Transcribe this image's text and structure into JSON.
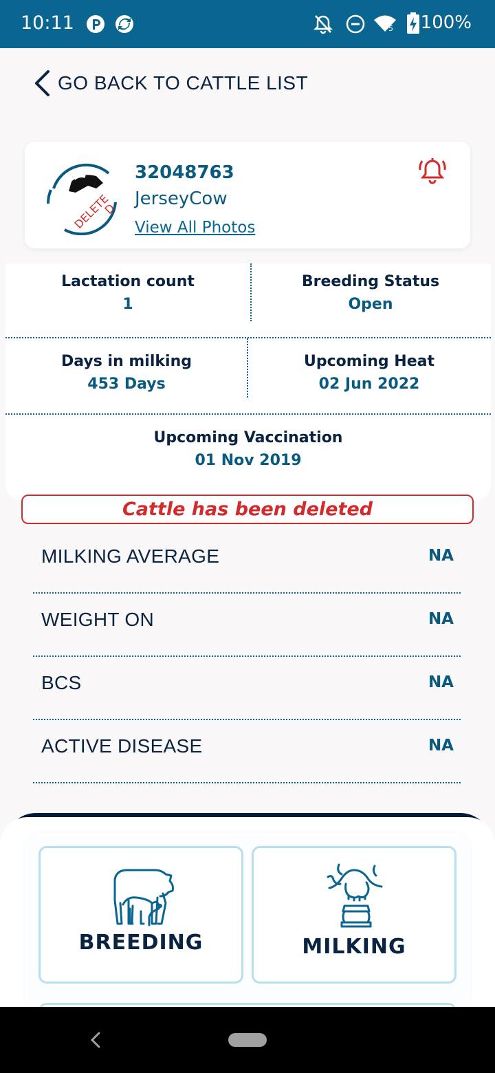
{
  "status_bar": {
    "time": "10:11",
    "battery": "100%",
    "network_badge": "5"
  },
  "back": {
    "label": "GO BACK TO CATTLE LIST"
  },
  "profile": {
    "id": "32048763",
    "breed": "JerseyCow",
    "view_photos": "View All Photos",
    "stamp_line1": "DELETE",
    "stamp_line2": "D"
  },
  "stats": {
    "lactation_label": "Lactation count",
    "lactation_value": "1",
    "breeding_label": "Breeding Status",
    "breeding_value": "Open",
    "milking_days_label": "Days in milking",
    "milking_days_value": "453 Days",
    "heat_label": "Upcoming Heat",
    "heat_value": "02 Jun 2022",
    "vaccination_label": "Upcoming Vaccination",
    "vaccination_value": "01 Nov 2019"
  },
  "banner": {
    "text": "Cattle has been deleted"
  },
  "info": [
    {
      "label": "MILKING AVERAGE",
      "value": "NA"
    },
    {
      "label": "WEIGHT ON",
      "value": "NA"
    },
    {
      "label": "BCS",
      "value": "NA"
    },
    {
      "label": "ACTIVE DISEASE",
      "value": "NA"
    }
  ],
  "modules": {
    "breeding": "BREEDING",
    "milking": "MILKING"
  },
  "colors": {
    "status_bar": "#0a6690",
    "accent": "#0a5a80",
    "danger": "#d12b2b",
    "navy": "#0a2340",
    "module_border": "#b7dfee"
  },
  "icons": [
    "parking-icon",
    "sync-icon",
    "bell-off-icon",
    "do-not-disturb-icon",
    "wifi-icon",
    "battery-icon",
    "chevron-left-icon",
    "bell-icon",
    "cow-calf-icon",
    "milking-icon"
  ]
}
